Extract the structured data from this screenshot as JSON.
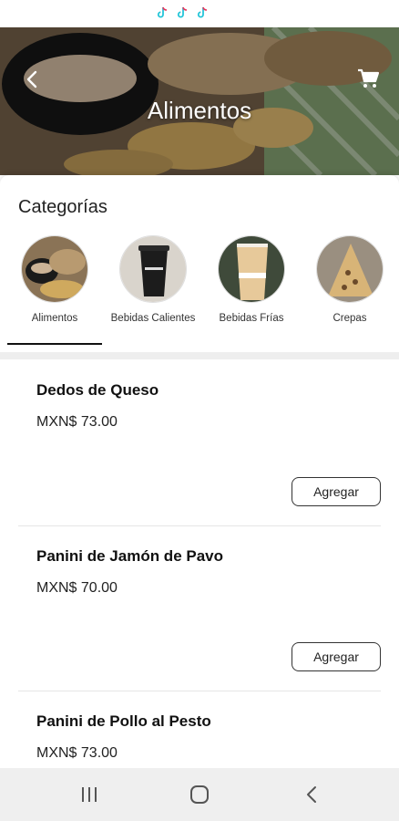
{
  "header": {
    "title": "Alimentos",
    "back_icon": "chevron-left-icon",
    "cart_icon": "shopping-cart-icon"
  },
  "categories": {
    "heading": "Categorías",
    "items": [
      {
        "label": "Alimentos",
        "selected": true
      },
      {
        "label": "Bebidas Calientes",
        "selected": false
      },
      {
        "label": "Bebidas Frías",
        "selected": false
      },
      {
        "label": "Crepas",
        "selected": false
      }
    ]
  },
  "products": [
    {
      "name": "Dedos de Queso",
      "price": "MXN$ 73.00",
      "button": "Agregar"
    },
    {
      "name": "Panini de Jamón de Pavo",
      "price": "MXN$ 70.00",
      "button": "Agregar"
    },
    {
      "name": "Panini de Pollo al Pesto",
      "price": "MXN$ 73.00",
      "button": "Agregar"
    }
  ],
  "colors": {
    "accent": "#111111",
    "nav_background": "#efefef",
    "divider": "#eeeeee"
  },
  "system_nav": {
    "recents_icon": "recents-icon",
    "home_icon": "home-icon",
    "back_icon": "back-icon"
  }
}
